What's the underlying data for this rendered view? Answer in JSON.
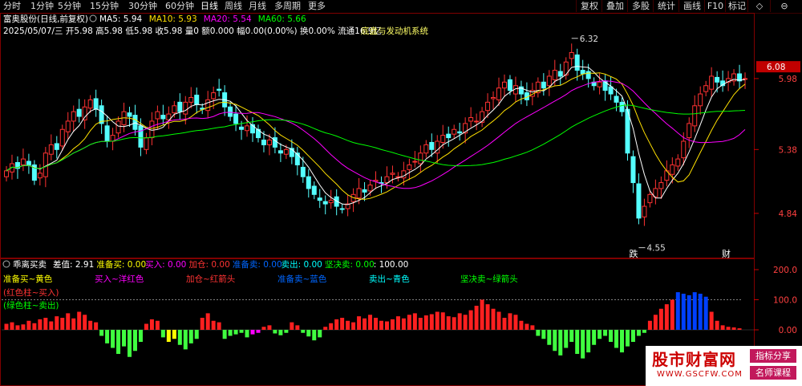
{
  "toolbar": {
    "periods": [
      "分时",
      "1分钟",
      "5分钟",
      "15分钟",
      "30分钟",
      "60分钟",
      "日线",
      "周线",
      "月线",
      "多周期",
      "更多"
    ],
    "active_period": "日线",
    "buttons": [
      "复权",
      "叠加",
      "多股",
      "统计",
      "画线",
      "F10",
      "标记",
      "◇",
      "⊖"
    ]
  },
  "header": {
    "stock_title": "富奥股份(日线,前复权)",
    "ma": [
      {
        "label": "MA5: 5.94",
        "color": "#ffffff"
      },
      {
        "label": "MA10: 5.93",
        "color": "#ffe000"
      },
      {
        "label": "MA20: 5.54",
        "color": "#ff00ff"
      },
      {
        "label": "MA60: 5.66",
        "color": "#00ff00"
      }
    ],
    "info_line": "2025/05/07/三  开5.98 高5.98 低5.98 收5.98 量0 额0.000  幅0.00(0.00%)  换0.00%  流通16.9亿",
    "system_name": "底盘与发动机系统"
  },
  "price_axis": {
    "labels": [
      "5.98",
      "5.38",
      "4.84"
    ],
    "current": "6.08",
    "current_color": "#c00000"
  },
  "annotations": {
    "high": "6.32",
    "low": "4.55",
    "event_1": "跌",
    "event_2": "财"
  },
  "indicator": {
    "name": "乖离买卖",
    "values_line": [
      {
        "text": "差值: 2.91",
        "color": "#ffffff"
      },
      {
        "text": "准备买: 0.00",
        "color": "#ffff00"
      },
      {
        "text": "买入: 0.00",
        "color": "#ff00ff"
      },
      {
        "text": "加仓: 0.00",
        "color": "#ff3333"
      },
      {
        "text": "准备卖: 0.00",
        "color": "#0066ff"
      },
      {
        "text": "卖出: 0.00",
        "color": "#00ffff"
      },
      {
        "text": "坚决卖: 0.00",
        "color": "#00ff00"
      },
      {
        "text": ": 100.00",
        "color": "#ffffff"
      }
    ],
    "legend": [
      {
        "text": "准备买~黄色",
        "color": "#ffff00"
      },
      {
        "text": "买入~洋红色",
        "color": "#ff00ff"
      },
      {
        "text": "加仓~红箭头",
        "color": "#ff3333"
      },
      {
        "text": "准备卖~蓝色",
        "color": "#0066ff"
      },
      {
        "text": "卖出~青色",
        "color": "#00ffff"
      },
      {
        "text": "坚决卖~绿箭头",
        "color": "#00ff00"
      }
    ],
    "notes": [
      {
        "text": "(红色柱~买入)",
        "color": "#ff3333"
      },
      {
        "text": "(绿色柱~卖出)",
        "color": "#00ff00"
      }
    ],
    "axis_labels": [
      "200.0",
      "100.0",
      "0.00"
    ]
  },
  "watermark": {
    "main": "股市财富网",
    "url": "WWW.GSCFW.COM",
    "tag1": "指标分享",
    "tag2": "名师课程"
  },
  "chart_data": {
    "type": "candlestick",
    "price_range": [
      4.5,
      6.4
    ],
    "closes": [
      5.2,
      5.26,
      5.22,
      5.3,
      5.25,
      5.12,
      5.18,
      5.35,
      5.42,
      5.38,
      5.55,
      5.62,
      5.7,
      5.66,
      5.74,
      5.8,
      5.72,
      5.6,
      5.45,
      5.5,
      5.62,
      5.7,
      5.66,
      5.55,
      5.4,
      5.48,
      5.62,
      5.7,
      5.64,
      5.68,
      5.75,
      5.7,
      5.78,
      5.82,
      5.76,
      5.72,
      5.8,
      5.86,
      5.88,
      5.74,
      5.66,
      5.6,
      5.55,
      5.58,
      5.52,
      5.48,
      5.42,
      5.46,
      5.4,
      5.35,
      5.38,
      5.32,
      5.25,
      5.15,
      5.05,
      5.0,
      4.95,
      4.92,
      4.95,
      4.9,
      4.88,
      4.92,
      5.0,
      5.05,
      5.02,
      5.08,
      5.12,
      5.1,
      5.15,
      5.18,
      5.15,
      5.2,
      5.25,
      5.28,
      5.35,
      5.42,
      5.38,
      5.45,
      5.5,
      5.48,
      5.55,
      5.52,
      5.6,
      5.65,
      5.62,
      5.7,
      5.78,
      5.82,
      5.9,
      5.95,
      5.88,
      5.92,
      5.85,
      5.8,
      5.88,
      5.95,
      5.9,
      6.0,
      6.05,
      6.0,
      6.12,
      6.2,
      6.05,
      6.02,
      5.98,
      5.92,
      5.95,
      5.88,
      5.85,
      5.78,
      5.7,
      5.35,
      5.1,
      4.8,
      4.9,
      5.0,
      5.05,
      5.1,
      5.2,
      5.25,
      5.3,
      5.45,
      5.6,
      5.75,
      5.85,
      5.92,
      6.0,
      5.95,
      5.92,
      5.98,
      6.02,
      5.96,
      5.98
    ],
    "ma_lines": [
      "MA5",
      "MA10",
      "MA20",
      "MA60"
    ],
    "indicator_values": [
      20,
      25,
      15,
      18,
      30,
      22,
      35,
      40,
      28,
      45,
      40,
      55,
      38,
      60,
      50,
      30,
      25,
      -20,
      -45,
      -60,
      -80,
      -55,
      -90,
      -70,
      -40,
      20,
      35,
      30,
      -25,
      -40,
      -30,
      -50,
      -65,
      -45,
      -30,
      40,
      55,
      30,
      25,
      -30,
      -20,
      -15,
      -10,
      -25,
      -15,
      -10,
      10,
      15,
      -12,
      -18,
      -10,
      25,
      15,
      -10,
      -22,
      -35,
      -25,
      10,
      22,
      35,
      40,
      30,
      25,
      45,
      38,
      50,
      40,
      30,
      28,
      35,
      45,
      38,
      50,
      55,
      40,
      48,
      52,
      60,
      58,
      45,
      42,
      55,
      50,
      65,
      80,
      100,
      85,
      70,
      60,
      40,
      55,
      50,
      30,
      20,
      15,
      -20,
      -30,
      -50,
      -70,
      -85,
      -60,
      -40,
      -80,
      -95,
      -75,
      -50,
      -30,
      -20,
      -40,
      -60,
      -75,
      -55,
      -40,
      -20,
      -10,
      30,
      50,
      70,
      85,
      100,
      125,
      120,
      115,
      125,
      120,
      110,
      60,
      30,
      15,
      10,
      8,
      5
    ]
  }
}
